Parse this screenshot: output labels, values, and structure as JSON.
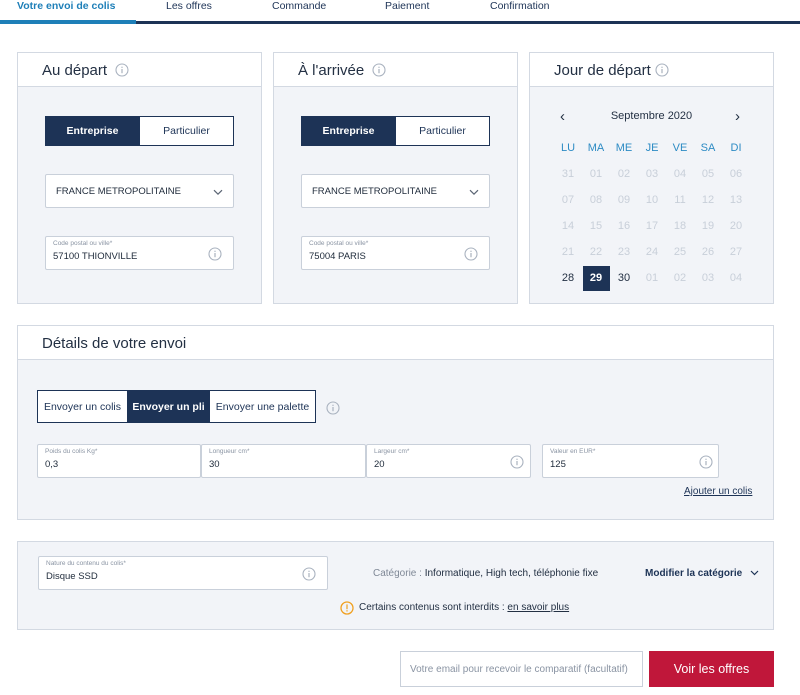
{
  "steps": [
    "Votre envoi de colis",
    "Les offres",
    "Commande",
    "Paiement",
    "Confirmation"
  ],
  "active_step": "Votre envoi de colis",
  "colors": {
    "navy": "#1d3356",
    "accent_blue": "#1e7fb8",
    "cta_red": "#c0173a",
    "warning": "#f0a020"
  },
  "departure": {
    "title": "Au départ",
    "toggle": {
      "left": "Entreprise",
      "right": "Particulier",
      "selected": "Entreprise"
    },
    "country": "FRANCE METROPOLITAINE",
    "postal_label": "Code postal ou ville*",
    "postal_value": "57100 THIONVILLE"
  },
  "arrival": {
    "title": "À l'arrivée",
    "toggle": {
      "left": "Entreprise",
      "right": "Particulier",
      "selected": "Entreprise"
    },
    "country": "FRANCE METROPOLITAINE",
    "postal_label": "Code postal ou ville*",
    "postal_value": "75004 PARIS"
  },
  "calendar": {
    "title": "Jour de départ",
    "month": "Septembre 2020",
    "prev": "‹",
    "next": "›",
    "weekdays": [
      "LU",
      "MA",
      "ME",
      "JE",
      "VE",
      "SA",
      "DI"
    ],
    "weeks": [
      [
        "31",
        "01",
        "02",
        "03",
        "04",
        "05",
        "06"
      ],
      [
        "07",
        "08",
        "09",
        "10",
        "11",
        "12",
        "13"
      ],
      [
        "14",
        "15",
        "16",
        "17",
        "18",
        "19",
        "20"
      ],
      [
        "21",
        "22",
        "23",
        "24",
        "25",
        "26",
        "27"
      ],
      [
        "28",
        "29",
        "30",
        "01",
        "02",
        "03",
        "04"
      ]
    ],
    "selected": "29",
    "selectable": [
      "28",
      "29",
      "30"
    ]
  },
  "details": {
    "title": "Détails de votre envoi",
    "types": [
      "Envoyer un colis",
      "Envoyer un pli",
      "Envoyer une palette"
    ],
    "selected_type": "Envoyer un pli",
    "weight": {
      "label": "Poids du colis Kg*",
      "value": "0,3"
    },
    "length": {
      "label": "Longueur cm*",
      "value": "30"
    },
    "width": {
      "label": "Largeur cm*",
      "value": "20"
    },
    "value_eur": {
      "label": "Valeur en EUR*",
      "value": "125"
    },
    "add_parcel": "Ajouter un colis"
  },
  "content": {
    "label": "Nature du contenu du colis*",
    "value": "Disque SSD",
    "category_prefix": "Catégorie :",
    "category_value": "Informatique, High tech, téléphonie fixe",
    "modify": "Modifier la catégorie",
    "warning_text": "Certains contenus sont interdits :",
    "warning_link": "en savoir plus"
  },
  "footer": {
    "email_placeholder": "Votre email pour recevoir le comparatif (facultatif)",
    "cta": "Voir les offres"
  }
}
